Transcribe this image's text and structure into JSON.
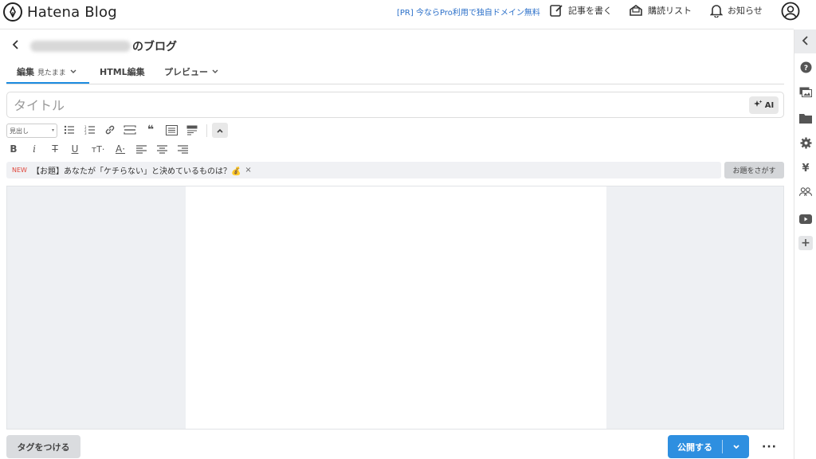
{
  "header": {
    "logo_text": "Hatena Blog",
    "pr_link": "[PR] 今ならPro利用で独自ドメイン無料",
    "write_label": "記事を書く",
    "subscribe_label": "購読リスト",
    "notify_label": "お知らせ"
  },
  "blog": {
    "title_suffix": "のブログ"
  },
  "tabs": [
    {
      "label": "編集",
      "sub": "見たまま"
    },
    {
      "label": "HTML編集"
    },
    {
      "label": "プレビュー"
    }
  ],
  "title_field": {
    "placeholder": "タイトル",
    "value": "",
    "ai_label": "AI"
  },
  "toolbar": {
    "heading_select": "見出し"
  },
  "topic": {
    "new_badge": "NEW",
    "text": "【お題】あなたが「ケチらない」と決めているものは？💰",
    "close": "×",
    "search_button": "お題をさがす"
  },
  "bottom": {
    "tag_button": "タグをつける",
    "publish_button": "公開する",
    "more": "···"
  },
  "colors": {
    "accent": "#2e8fe0",
    "tab_underline": "#1d8ce0",
    "pr_link": "#2a6fc9",
    "new_badge": "#e0463b"
  }
}
